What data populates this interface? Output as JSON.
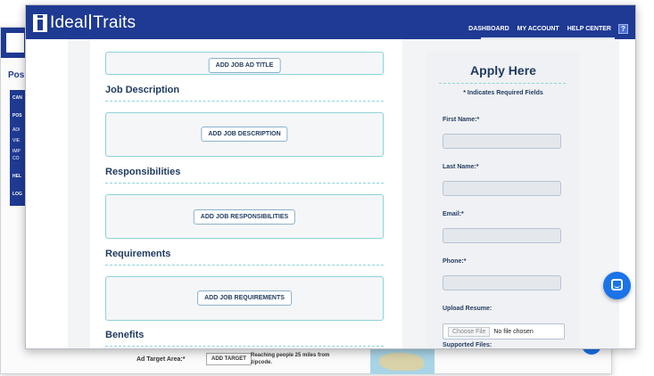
{
  "background_window": {
    "sidebar_heading": "Pos",
    "sidebar_items": [
      "CAN",
      "POS",
      "ADI",
      "VIE",
      "IMP",
      "CO",
      "HEL",
      "LOG"
    ],
    "ad_target_label": "Ad Target Area:*",
    "add_target_label": "ADD TARGET",
    "target_note": "Reaching people 25 miles from zipcode."
  },
  "header": {
    "logo_left": "Ideal",
    "logo_right": "Traits",
    "nav": [
      "DASHBOARD",
      "MY ACCOUNT",
      "HELP CENTER"
    ],
    "help_label": "?"
  },
  "main": {
    "add_title_label": "ADD JOB AD TITLE",
    "sections": [
      {
        "title": "Job Description",
        "button": "ADD JOB DESCRIPTION"
      },
      {
        "title": "Responsibilities",
        "button": "ADD JOB RESPONSIBILITIES"
      },
      {
        "title": "Requirements",
        "button": "ADD JOB REQUIREMENTS"
      },
      {
        "title": "Benefits"
      }
    ]
  },
  "apply": {
    "title": "Apply Here",
    "required_note": "* Indicates Required Fields",
    "fields": [
      {
        "label": "First Name:*",
        "value": ""
      },
      {
        "label": "Last Name:*",
        "value": ""
      },
      {
        "label": "Email:*",
        "value": ""
      },
      {
        "label": "Phone:*",
        "value": ""
      }
    ],
    "upload_label": "Upload Resume:",
    "choose_file": "Choose File",
    "no_file": "No file chosen",
    "supported_files": "Supported Files:"
  },
  "colors": {
    "header": "#1f3a93",
    "accent_border": "#8dd3d9",
    "heading_text": "#1f3a5f",
    "chat": "#1a73e8"
  }
}
